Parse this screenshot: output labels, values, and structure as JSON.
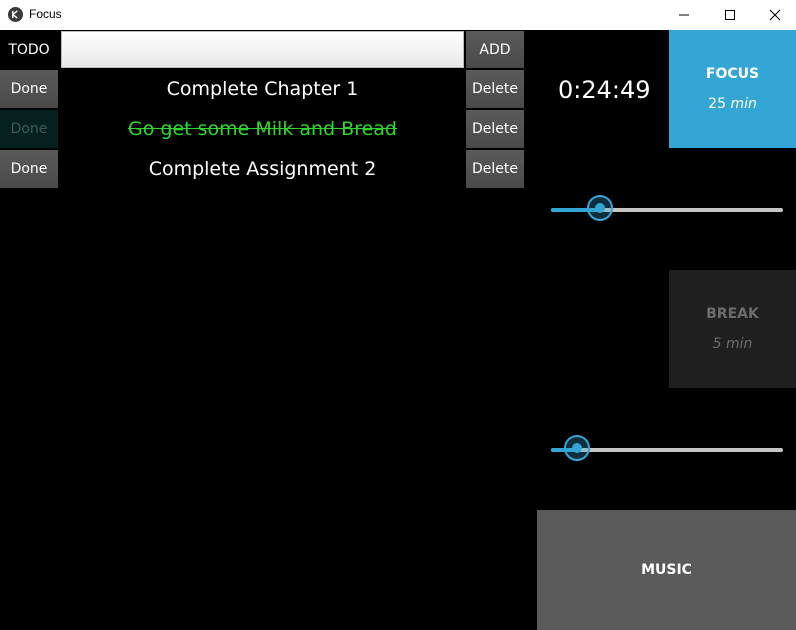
{
  "window": {
    "title": "Focus"
  },
  "todo": {
    "label": "TODO",
    "input_value": "",
    "add_label": "ADD",
    "tasks": [
      {
        "done_label": "Done",
        "text": "Complete Chapter 1",
        "completed": false,
        "delete_label": "Delete"
      },
      {
        "done_label": "Done",
        "text": "Go get some Milk and Bread",
        "completed": true,
        "delete_label": "Delete"
      },
      {
        "done_label": "Done",
        "text": "Complete Assignment 2",
        "completed": false,
        "delete_label": "Delete"
      }
    ]
  },
  "timer": {
    "display": "0:24:49"
  },
  "focus": {
    "title": "FOCUS",
    "minutes": "25",
    "unit": "min",
    "slider_fraction": 0.21
  },
  "break": {
    "title": "BREAK",
    "minutes": "5",
    "unit": "min",
    "slider_fraction": 0.11
  },
  "music": {
    "label": "MUSIC"
  },
  "colors": {
    "accent": "#33a6d6",
    "completed_text": "#2cd82c",
    "button": "#5a5a5a"
  }
}
